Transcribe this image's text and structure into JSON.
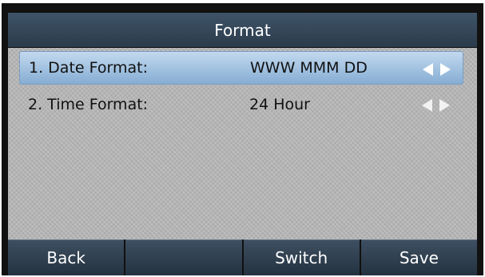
{
  "title": "Format",
  "items": [
    {
      "label": "1. Date Format:",
      "value": "WWW MMM DD",
      "selected": true
    },
    {
      "label": "2. Time Format:",
      "value": "24 Hour",
      "selected": false
    }
  ],
  "softkeys": [
    "Back",
    "",
    "Switch",
    "Save"
  ],
  "colors": {
    "title_bg": "#34485b",
    "selected_row": "#a9c6e3",
    "content_bg": "#b7b7b7",
    "softkey_bg": "#2f3f50"
  },
  "icons": {
    "value_nav": [
      "left-arrow-icon",
      "right-arrow-icon"
    ]
  }
}
